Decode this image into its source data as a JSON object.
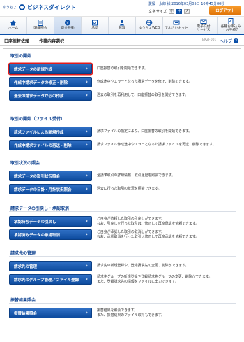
{
  "header": {
    "bank_label": "ゆうちょ",
    "logo_text": "ビジネスダイレクト",
    "user_text": "愛媛　太郎 様 2016年03月05日 10時45分00秒",
    "font_size_label": "文字サイズ",
    "font_sizes": [
      "小",
      "中",
      "大"
    ],
    "logout_label": "ログアウト"
  },
  "nav": [
    {
      "label": "ホーム",
      "icon": "home-icon"
    },
    {
      "label": "明細照会",
      "icon": "statement-icon"
    },
    {
      "label": "資金移動",
      "icon": "transfer-icon",
      "active": true
    },
    {
      "label": "承認",
      "icon": "approval-icon"
    },
    {
      "label": "管理",
      "icon": "admin-icon"
    },
    {
      "label": "ゆうちょWEB",
      "icon": "web-icon"
    },
    {
      "label": "でんさいネット",
      "icon": "densai-icon"
    },
    {
      "label": "電子交付\nサービス",
      "icon": "e-delivery-icon"
    },
    {
      "label": "各種お申込み\n・お手続き",
      "icon": "application-icon"
    }
  ],
  "page": {
    "breadcrumb_1": "口座振替依頼",
    "breadcrumb_2": "作業内容選択",
    "screen_id": "BKZF001",
    "help_label": "ヘルプ"
  },
  "sections": [
    {
      "title": "取引の開始",
      "items": [
        {
          "label": "請求データの新規作成",
          "desc": "口座振替の取引を開始できます。",
          "focus": true
        },
        {
          "label": "作成中請求データの修正・削除",
          "desc": "作成途中やエラーとなった請求データを修正、削除できます。"
        },
        {
          "label": "過去の請求データからの作成",
          "desc": "過去の取引を再利用して、口座振替の取引を開始できます。"
        }
      ]
    },
    {
      "title": "取引の開始（ファイル受付）",
      "items": [
        {
          "label": "請求ファイルによる新規作成",
          "desc": "請求ファイルの指定により、口座振替の取引を開始できます。"
        },
        {
          "label": "作成中請求ファイルの再送・削除",
          "desc": "請求ファイル作成途中やエラーとなった請求ファイルを再送、削除できます。"
        }
      ]
    },
    {
      "title": "取引状況の照会",
      "items": [
        {
          "label": "請求データの取引状況照会",
          "desc": "全請求取引の詳細情報、取引履歴を照会できます。"
        },
        {
          "label": "請求データの日計・月計状況照会",
          "desc": "過去に行った取引の状況を照会できます。"
        }
      ]
    },
    {
      "title": "請求データの引戻し・承認取消",
      "items": [
        {
          "label": "承認待ちデータの引戻し",
          "desc": "ご自身が依頼した取引の引戻しができます。\nなお、引戻しを行った取引は、修正して再度承認を依頼できます。"
        },
        {
          "label": "承認済みデータの承認取消",
          "desc": "ご自身が承認した取引の取消しができます。\nなお、承認取消を行った取引は修正して再度承認を依頼できます。"
        }
      ]
    },
    {
      "title": "請求先の管理",
      "items": [
        {
          "label": "請求先の管理",
          "desc": "請求先の新規登録や、登録請求先の変更、削除ができます。"
        },
        {
          "label": "請求先のグループ管理／ファイル登録",
          "desc": "請求先グループの新規登録や登録請求先グループの変更、削除ができます。\nまた、登録請求先の情報をファイルに出力できます。"
        }
      ]
    },
    {
      "title": "振替結果照会",
      "items": [
        {
          "label": "振替結果照会",
          "desc": "振替結果を照会できます。\nまた、振替結果のファイル取得もできます。"
        }
      ]
    }
  ]
}
